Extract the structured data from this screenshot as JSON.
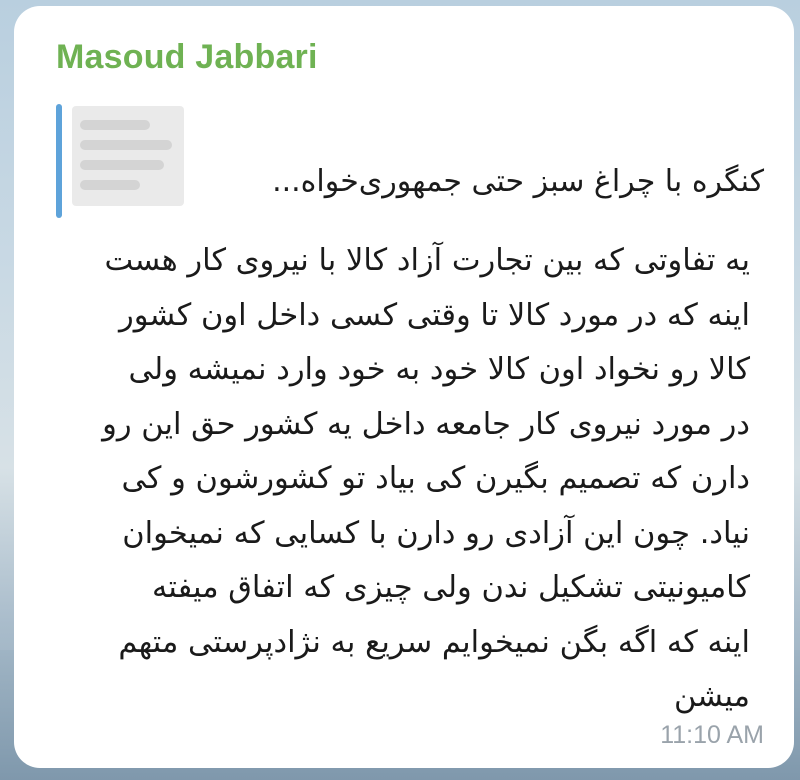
{
  "message": {
    "sender_name": "Masoud Jabbari",
    "sender_color": "#6fb253",
    "reply": {
      "quoted_text": "کنگره با چراغ سبز حتی جمهوری‌خواه...",
      "bar_color": "#5ea3da"
    },
    "body_lines": [
      "یه تفاوتی که بین تجارت آزاد کالا با نیروی کار هست",
      "اینه که در مورد کالا تا وقتی کسی داخل اون کشور",
      "کالا رو نخواد اون کالا خود به خود وارد نمیشه ولی",
      "در مورد نیروی کار جامعه داخل یه کشور حق این رو",
      "دارن که تصمیم بگیرن کی بیاد تو کشورشون و کی",
      "نیاد. چون این آزادی رو دارن با کسایی که نمیخوان",
      "کامیونیتی تشکیل ندن ولی چیزی که اتفاق میفته",
      "اینه که اگه بگن نمیخوایم سریع به نژادپرستی متهم",
      "میشن"
    ],
    "time": "11:10 AM"
  }
}
